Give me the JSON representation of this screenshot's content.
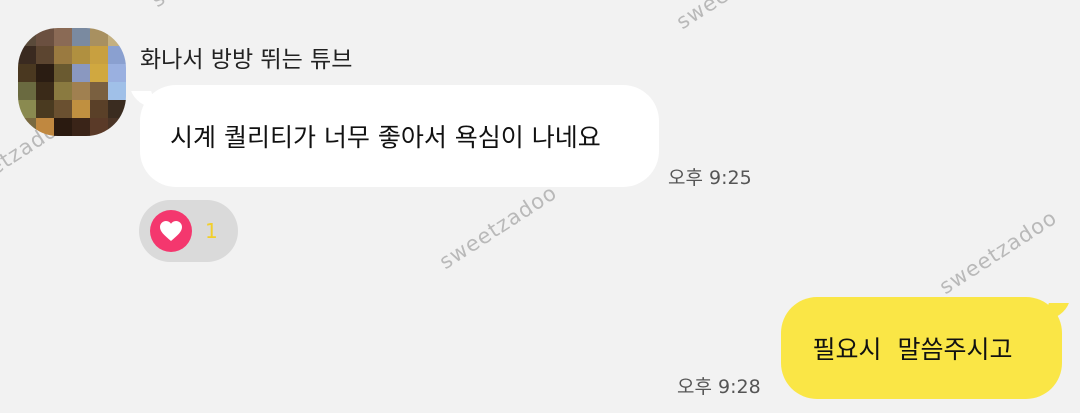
{
  "watermark_text": "sweetzadoo",
  "incoming": {
    "sender_name": "화나서 방방 뛰는 튜브",
    "message": "시계 퀄리티가 너무 좋아서 욕심이 나네요",
    "time": "오후 9:25",
    "reaction": {
      "icon": "heart-icon",
      "count": "1",
      "color": "#f4376e"
    }
  },
  "outgoing": {
    "message": "필요시  말씀주시고",
    "time": "오후 9:28",
    "bubble_color": "#fae646"
  }
}
